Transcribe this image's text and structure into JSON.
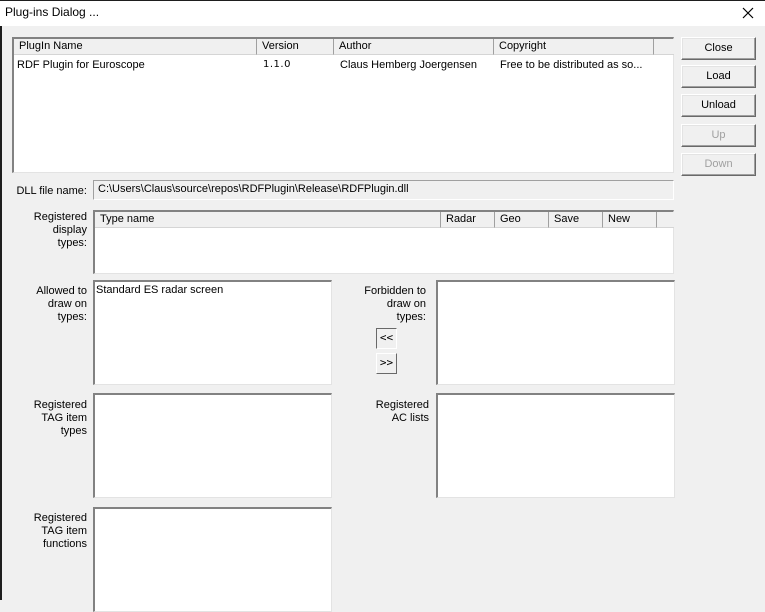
{
  "window": {
    "title": "Plug-ins Dialog ...",
    "close_glyph": "✕"
  },
  "plugins_table": {
    "columns": [
      "PlugIn Name",
      "Version",
      "Author",
      "Copyright"
    ],
    "rows": [
      {
        "name": "RDF Plugin for Euroscope",
        "version": "1.1.0",
        "author": "Claus Hemberg Joergensen",
        "copyright": "Free to be distributed as so..."
      }
    ]
  },
  "buttons": {
    "close": "Close",
    "load": "Load",
    "unload": "Unload",
    "up": "Up",
    "down": "Down"
  },
  "dll": {
    "label": "DLL file name:",
    "value": "C:\\Users\\Claus\\source\\repos\\RDFPlugin\\Release\\RDFPlugin.dll"
  },
  "display_types": {
    "label_lines": [
      "Registered",
      "display",
      "types:"
    ],
    "columns": [
      "Type name",
      "Radar",
      "Geo",
      "Save",
      "New"
    ],
    "rows": []
  },
  "allowed": {
    "label_lines": [
      "Allowed to",
      "draw on",
      "types:"
    ],
    "items": [
      "Standard ES radar screen"
    ]
  },
  "forbidden": {
    "label_lines": [
      "Forbidden to",
      "draw on",
      "types:"
    ],
    "items": []
  },
  "move_buttons": {
    "move_left": "<<",
    "move_right": ">>"
  },
  "tag_item_types": {
    "label_lines": [
      "Registered",
      "TAG item",
      "types"
    ],
    "items": []
  },
  "ac_lists": {
    "label_lines": [
      "Registered",
      "AC lists"
    ],
    "items": []
  },
  "tag_item_functions": {
    "label_lines": [
      "Registered",
      "TAG item",
      "functions"
    ],
    "items": []
  }
}
